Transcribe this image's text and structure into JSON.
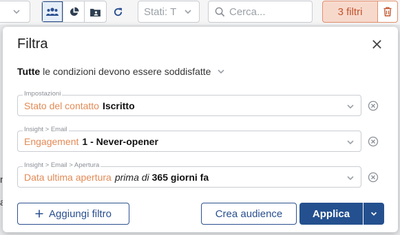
{
  "toolbar": {
    "view_buttons": [
      "people-icon",
      "pie-chart-icon",
      "contact-folder-icon"
    ],
    "stati_placeholder": "Stati: T",
    "search_placeholder": "Cerca...",
    "filters_label": "3 filtri"
  },
  "background": {
    "line1": "n",
    "line2": "a"
  },
  "modal": {
    "title": "Filtra",
    "condition_bold": "Tutte",
    "condition_text": "le condizioni devono essere soddisfatte",
    "filters": [
      {
        "group": "Impostazioni",
        "field": "Stato del contatto",
        "operator": "",
        "value": "Iscritto"
      },
      {
        "group": "Insight > Email",
        "field": "Engagement",
        "operator": "",
        "value": "1 - Never-opener"
      },
      {
        "group": "Insight > Email > Apertura",
        "field": "Data ultima apertura",
        "operator": "prima di",
        "value": "365 giorni fa"
      }
    ],
    "add_filter_label": "Aggiungi filtro",
    "create_audience_label": "Crea audience",
    "apply_label": "Applica"
  },
  "colors": {
    "accent": "#24508f",
    "orange": "#e38a55",
    "filter_badge_bg": "#f7d9cc"
  }
}
